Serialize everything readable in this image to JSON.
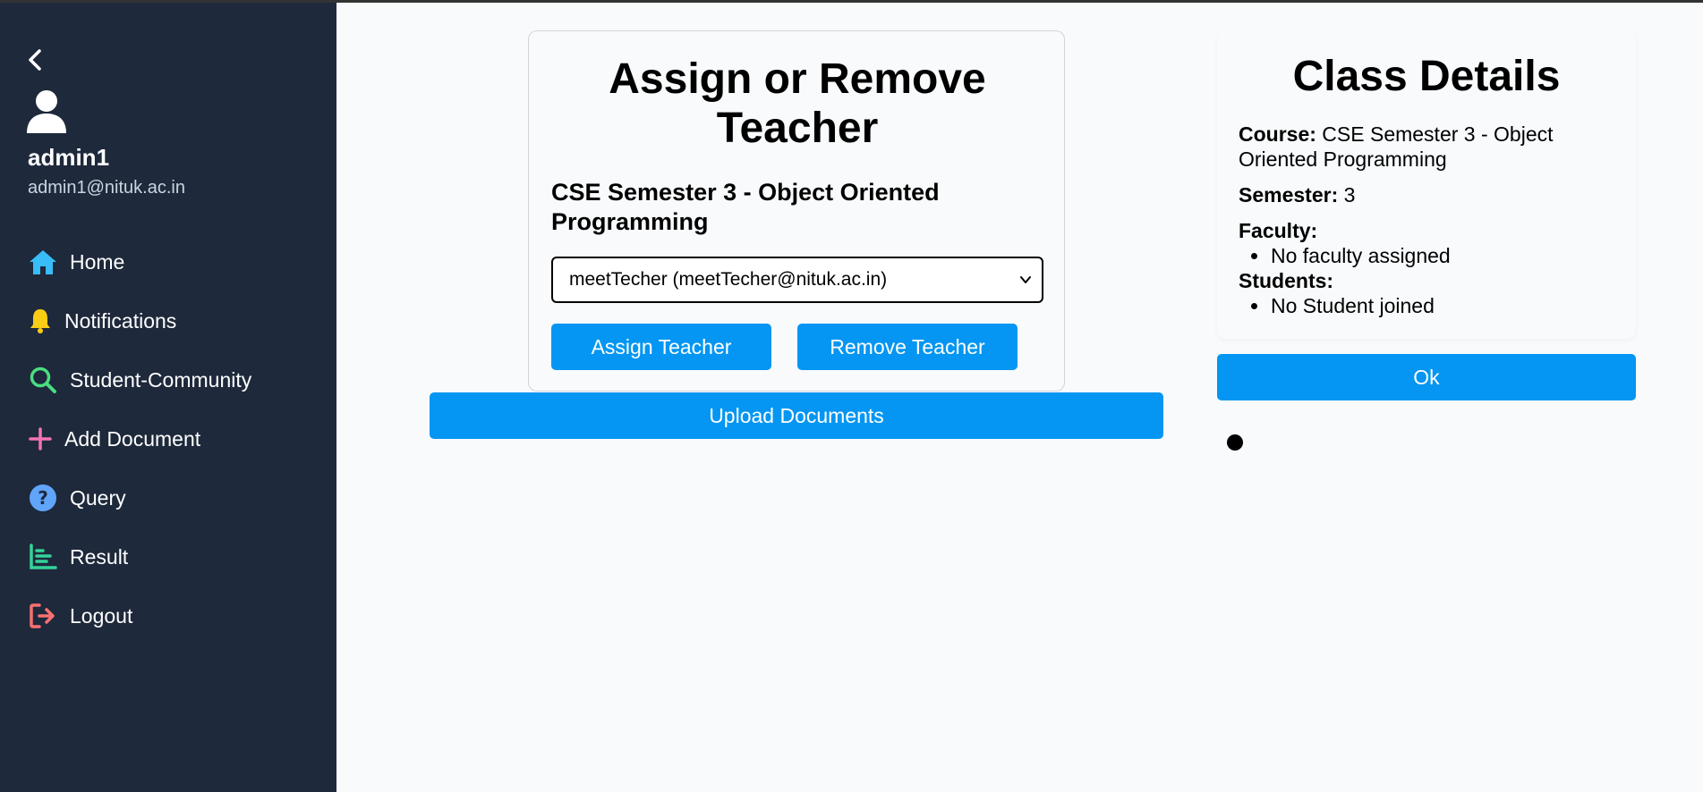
{
  "sidebar": {
    "user": {
      "name": "admin1",
      "email": "admin1@nituk.ac.in"
    },
    "items": [
      {
        "label": "Home",
        "icon": "home-icon",
        "color": "#38bdf8"
      },
      {
        "label": "Notifications",
        "icon": "bell-icon",
        "color": "#facc15"
      },
      {
        "label": "Student-Community",
        "icon": "search-icon",
        "color": "#4ade80"
      },
      {
        "label": "Add Document",
        "icon": "plus-icon",
        "color": "#f472b6"
      },
      {
        "label": "Query",
        "icon": "question-icon",
        "color": "#60a5fa"
      },
      {
        "label": "Result",
        "icon": "bar-chart-icon",
        "color": "#34d399"
      },
      {
        "label": "Logout",
        "icon": "logout-icon",
        "color": "#f87171"
      }
    ]
  },
  "assign": {
    "title": "Assign or Remove Teacher",
    "course": "CSE Semester 3 - Object Oriented Programming",
    "selected_teacher": "meetTecher (meetTecher@nituk.ac.in)",
    "assign_label": "Assign Teacher",
    "remove_label": "Remove Teacher",
    "upload_label": "Upload Documents"
  },
  "details": {
    "title": "Class Details",
    "course_label": "Course:",
    "course_value": "CSE Semester 3 - Object Oriented Programming",
    "semester_label": "Semester:",
    "semester_value": "3",
    "faculty_label": "Faculty:",
    "faculty_items": [
      "No faculty assigned"
    ],
    "students_label": "Students:",
    "student_items": [
      "No Student joined"
    ],
    "ok_label": "Ok"
  },
  "colors": {
    "sidebar_bg": "#1e293b",
    "accent": "#0496f2",
    "page_bg": "#f8fafc"
  }
}
